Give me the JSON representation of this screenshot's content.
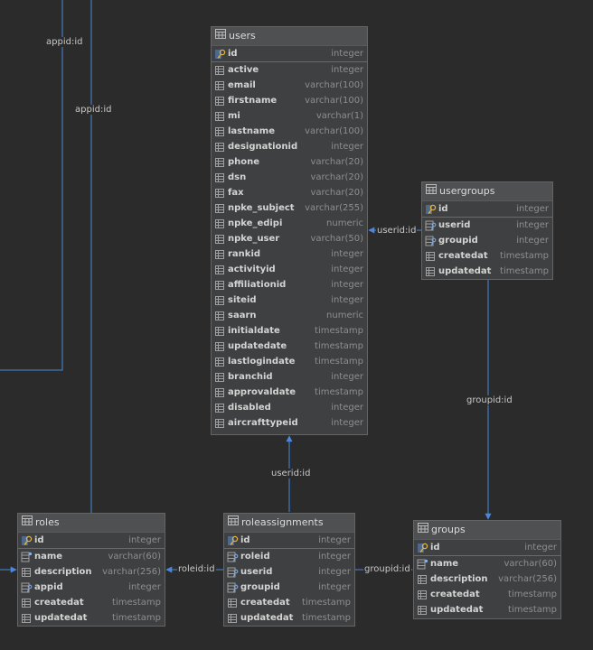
{
  "tables": [
    {
      "id": "users",
      "name": "users",
      "columns": [
        {
          "name": "id",
          "type": "integer",
          "icon": "primary-key-icon",
          "pk": true
        },
        {
          "name": "active",
          "type": "integer",
          "icon": "column-icon"
        },
        {
          "name": "email",
          "type": "varchar(100)",
          "icon": "column-icon"
        },
        {
          "name": "firstname",
          "type": "varchar(100)",
          "icon": "column-icon"
        },
        {
          "name": "mi",
          "type": "varchar(1)",
          "icon": "column-icon"
        },
        {
          "name": "lastname",
          "type": "varchar(100)",
          "icon": "column-icon"
        },
        {
          "name": "designationid",
          "type": "integer",
          "icon": "column-icon"
        },
        {
          "name": "phone",
          "type": "varchar(20)",
          "icon": "column-icon"
        },
        {
          "name": "dsn",
          "type": "varchar(20)",
          "icon": "column-icon"
        },
        {
          "name": "fax",
          "type": "varchar(20)",
          "icon": "column-icon"
        },
        {
          "name": "npke_subject",
          "type": "varchar(255)",
          "icon": "column-icon"
        },
        {
          "name": "npke_edipi",
          "type": "numeric",
          "icon": "column-icon"
        },
        {
          "name": "npke_user",
          "type": "varchar(50)",
          "icon": "column-icon"
        },
        {
          "name": "rankid",
          "type": "integer",
          "icon": "column-icon"
        },
        {
          "name": "activityid",
          "type": "integer",
          "icon": "column-icon"
        },
        {
          "name": "affiliationid",
          "type": "integer",
          "icon": "column-icon"
        },
        {
          "name": "siteid",
          "type": "integer",
          "icon": "column-icon"
        },
        {
          "name": "saarn",
          "type": "numeric",
          "icon": "column-icon"
        },
        {
          "name": "initialdate",
          "type": "timestamp",
          "icon": "column-icon"
        },
        {
          "name": "updatedate",
          "type": "timestamp",
          "icon": "column-icon"
        },
        {
          "name": "lastlogindate",
          "type": "timestamp",
          "icon": "column-icon"
        },
        {
          "name": "branchid",
          "type": "integer",
          "icon": "column-icon"
        },
        {
          "name": "approvaldate",
          "type": "timestamp",
          "icon": "column-icon"
        },
        {
          "name": "disabled",
          "type": "integer",
          "icon": "column-icon"
        },
        {
          "name": "aircrafttypeid",
          "type": "integer",
          "icon": "column-icon"
        }
      ]
    },
    {
      "id": "usergroups",
      "name": "usergroups",
      "columns": [
        {
          "name": "id",
          "type": "integer",
          "icon": "primary-key-icon",
          "pk": true
        },
        {
          "name": "userid",
          "type": "integer",
          "icon": "foreign-key-icon"
        },
        {
          "name": "groupid",
          "type": "integer",
          "icon": "foreign-key-icon"
        },
        {
          "name": "createdat",
          "type": "timestamp",
          "icon": "column-icon"
        },
        {
          "name": "updatedat",
          "type": "timestamp",
          "icon": "column-icon"
        }
      ]
    },
    {
      "id": "roles",
      "name": "roles",
      "columns": [
        {
          "name": "id",
          "type": "integer",
          "icon": "primary-key-icon",
          "pk": true
        },
        {
          "name": "name",
          "type": "varchar(60)",
          "icon": "index-column-icon"
        },
        {
          "name": "description",
          "type": "varchar(256)",
          "icon": "column-icon"
        },
        {
          "name": "appid",
          "type": "integer",
          "icon": "foreign-key-icon"
        },
        {
          "name": "createdat",
          "type": "timestamp",
          "icon": "column-icon"
        },
        {
          "name": "updatedat",
          "type": "timestamp",
          "icon": "column-icon"
        }
      ]
    },
    {
      "id": "roleassignments",
      "name": "roleassignments",
      "columns": [
        {
          "name": "id",
          "type": "integer",
          "icon": "primary-key-icon",
          "pk": true
        },
        {
          "name": "roleid",
          "type": "integer",
          "icon": "foreign-key-icon"
        },
        {
          "name": "userid",
          "type": "integer",
          "icon": "foreign-key-icon"
        },
        {
          "name": "groupid",
          "type": "integer",
          "icon": "foreign-key-icon"
        },
        {
          "name": "createdat",
          "type": "timestamp",
          "icon": "column-icon"
        },
        {
          "name": "updatedat",
          "type": "timestamp",
          "icon": "column-icon"
        }
      ]
    },
    {
      "id": "groups",
      "name": "groups",
      "columns": [
        {
          "name": "id",
          "type": "integer",
          "icon": "primary-key-icon",
          "pk": true
        },
        {
          "name": "name",
          "type": "varchar(60)",
          "icon": "index-column-icon"
        },
        {
          "name": "description",
          "type": "varchar(256)",
          "icon": "column-icon"
        },
        {
          "name": "createdat",
          "type": "timestamp",
          "icon": "column-icon"
        },
        {
          "name": "updatedat",
          "type": "timestamp",
          "icon": "column-icon"
        }
      ]
    }
  ],
  "relation_labels": {
    "appid_top": "appid:id",
    "appid_roles": "appid:id",
    "usergroups_userid": "userid:id",
    "usergroups_groupid": "groupid:id",
    "roleassignments_userid": "userid:id",
    "roleassignments_roleid": "roleid:id",
    "roleassignments_groupid": "groupid:id"
  },
  "colors": {
    "background": "#2b2b2b",
    "table_body": "#3f4041",
    "table_header": "#4e5052",
    "relation_line": "#4a88e0",
    "text": "#d4d4d4",
    "type_text": "#8e8e8e"
  }
}
